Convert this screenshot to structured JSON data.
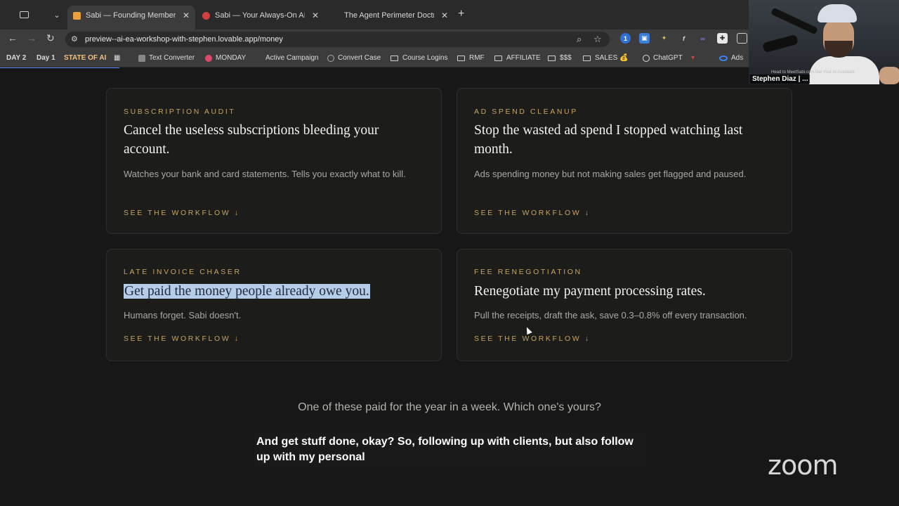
{
  "browser": {
    "tabs": [
      {
        "title": "Sabi — Founding Member Se",
        "active": true,
        "color": "#e8a040"
      },
      {
        "title": "Sabi — Your Always-On AI As",
        "active": false,
        "color": "#d04040"
      },
      {
        "title": "The Agent Perimeter Doctrine",
        "active": false,
        "color": ""
      }
    ],
    "url": "preview--ai-ea-workshop-with-stephen.lovable.app/money",
    "bookmarks": [
      {
        "label": "DAY 2",
        "bold": true
      },
      {
        "label": "Day 1",
        "bold": true
      },
      {
        "label": "STATE OF AI",
        "bold": true
      },
      {
        "label": "Text Converter",
        "bold": false
      },
      {
        "label": "MONDAY",
        "bold": false
      },
      {
        "label": "Active Campaign",
        "bold": false
      },
      {
        "label": "Convert Case",
        "bold": false
      },
      {
        "label": "Course Logins",
        "bold": false
      },
      {
        "label": "RMF",
        "bold": false
      },
      {
        "label": "AFFILIATE",
        "bold": false
      },
      {
        "label": "$$$",
        "bold": false
      },
      {
        "label": "SALES 💰",
        "bold": false
      },
      {
        "label": "ChatGPT",
        "bold": false
      },
      {
        "label": "Ads",
        "bold": false
      }
    ]
  },
  "cards": [
    {
      "eyebrow": "SUBSCRIPTION AUDIT",
      "headline": "Cancel the useless subscriptions bleeding your account.",
      "body": "Watches your bank and card statements. Tells you exactly what to kill.",
      "link": "SEE THE WORKFLOW ↓"
    },
    {
      "eyebrow": "AD SPEND CLEANUP",
      "headline": "Stop the wasted ad spend I stopped watching last month.",
      "body": "Ads spending money but not making sales get flagged and paused.",
      "link": "SEE THE WORKFLOW ↓"
    },
    {
      "eyebrow": "LATE INVOICE CHASER",
      "headline": "Get paid the money people already owe you.",
      "body": "Humans forget. Sabi doesn't.",
      "link": "SEE THE WORKFLOW ↓"
    },
    {
      "eyebrow": "FEE RENEGOTIATION",
      "headline": "Renegotiate my payment processing rates.",
      "body": "Pull the receipts, draft the ask, save 0.3–0.8% off every transaction.",
      "link": "SEE THE WORKFLOW ↓"
    }
  ],
  "tagline": "One of these paid for the year in a week. Which one's yours?",
  "caption": "And get stuff done, okay? So, following up with clients, but also follow up with my personal",
  "video": {
    "participant_name": "Stephen Diaz | ...",
    "overlay_note": "Head to MeetSabi.com Get Your AI Assistant",
    "app_logo": "zoom"
  }
}
